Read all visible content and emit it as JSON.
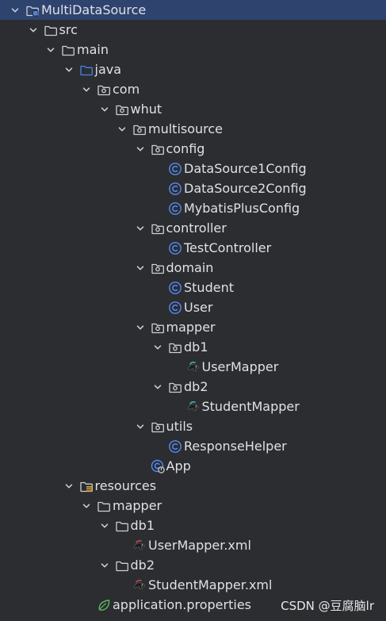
{
  "tree": [
    {
      "label": "MultiDataSource",
      "depth": 0,
      "icon": "module-folder-icon",
      "expanded": true,
      "selected": true
    },
    {
      "label": "src",
      "depth": 1,
      "icon": "folder-icon",
      "expanded": true
    },
    {
      "label": "main",
      "depth": 2,
      "icon": "folder-icon",
      "expanded": true
    },
    {
      "label": "java",
      "depth": 3,
      "icon": "source-root-folder-icon",
      "expanded": true
    },
    {
      "label": "com",
      "depth": 4,
      "icon": "package-icon",
      "expanded": true
    },
    {
      "label": "whut",
      "depth": 5,
      "icon": "package-icon",
      "expanded": true
    },
    {
      "label": "multisource",
      "depth": 6,
      "icon": "package-icon",
      "expanded": true
    },
    {
      "label": "config",
      "depth": 7,
      "icon": "package-icon",
      "expanded": true
    },
    {
      "label": "DataSource1Config",
      "depth": 8,
      "icon": "java-class-icon"
    },
    {
      "label": "DataSource2Config",
      "depth": 8,
      "icon": "java-class-icon"
    },
    {
      "label": "MybatisPlusConfig",
      "depth": 8,
      "icon": "java-class-icon"
    },
    {
      "label": "controller",
      "depth": 7,
      "icon": "package-icon",
      "expanded": true
    },
    {
      "label": "TestController",
      "depth": 8,
      "icon": "java-class-icon"
    },
    {
      "label": "domain",
      "depth": 7,
      "icon": "package-icon",
      "expanded": true
    },
    {
      "label": "Student",
      "depth": 8,
      "icon": "java-class-icon"
    },
    {
      "label": "User",
      "depth": 8,
      "icon": "java-class-icon"
    },
    {
      "label": "mapper",
      "depth": 7,
      "icon": "package-icon",
      "expanded": true
    },
    {
      "label": "db1",
      "depth": 8,
      "icon": "package-icon",
      "expanded": true
    },
    {
      "label": "UserMapper",
      "depth": 9,
      "icon": "mybatis-mapper-icon"
    },
    {
      "label": "db2",
      "depth": 8,
      "icon": "package-icon",
      "expanded": true
    },
    {
      "label": "StudentMapper",
      "depth": 9,
      "icon": "mybatis-mapper-icon"
    },
    {
      "label": "utils",
      "depth": 7,
      "icon": "package-icon",
      "expanded": true
    },
    {
      "label": "ResponseHelper",
      "depth": 8,
      "icon": "java-class-icon"
    },
    {
      "label": "App",
      "depth": 7,
      "icon": "spring-boot-app-icon"
    },
    {
      "label": "resources",
      "depth": 3,
      "icon": "resources-folder-icon",
      "expanded": true
    },
    {
      "label": "mapper",
      "depth": 4,
      "icon": "folder-icon",
      "expanded": true
    },
    {
      "label": "db1",
      "depth": 5,
      "icon": "folder-icon",
      "expanded": true
    },
    {
      "label": "UserMapper.xml",
      "depth": 6,
      "icon": "mybatis-xml-icon"
    },
    {
      "label": "db2",
      "depth": 5,
      "icon": "folder-icon",
      "expanded": true
    },
    {
      "label": "StudentMapper.xml",
      "depth": 6,
      "icon": "mybatis-xml-icon"
    },
    {
      "label": "application.properties",
      "depth": 4,
      "icon": "spring-properties-icon"
    }
  ],
  "watermark": "CSDN @豆腐脑lr",
  "colors": {
    "background": "#2b2d30",
    "selected_row": "#2e436e",
    "text": "#dfe1e5",
    "icon_gray": "#ced0d6",
    "class_blue": "#548af7",
    "source_blue": "#4b83e8",
    "spring_green": "#5fb865",
    "resources_yellow": "#d9a343"
  }
}
